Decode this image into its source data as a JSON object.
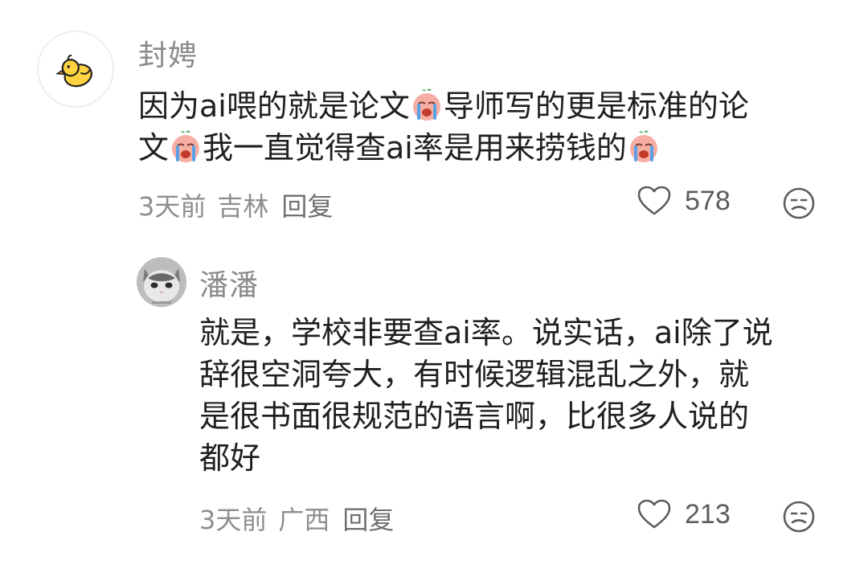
{
  "comments": [
    {
      "username": "封娉",
      "avatar_icon": "duck-avatar-icon",
      "content_segments": [
        [
          "因为ai喂的就是论文",
          "crying-emoji",
          "导师写的更是标准的论"
        ],
        [
          "文",
          "crying-emoji",
          "我一直觉得查ai率是用来捞钱的",
          "crying-emoji"
        ]
      ],
      "time": "3天前",
      "location": "吉林",
      "reply_label": "回复",
      "likes": "578"
    },
    {
      "username": "潘潘",
      "avatar_icon": "kitten-avatar-icon",
      "content_lines": [
        "就是，学校非要查ai率。说实话，ai除了说",
        "辞很空洞夸大，有时候逻辑混乱之外，就",
        "是很书面很规范的语言啊，比很多人说的",
        "都好"
      ],
      "time": "3天前",
      "location": "广西",
      "reply_label": "回复",
      "likes": "213"
    }
  ],
  "icons": {
    "like": "heart-outline-icon",
    "dislike": "unhappy-face-icon",
    "emoji": "crying-emoji"
  },
  "colors": {
    "text_primary": "#1f1f1f",
    "text_secondary": "#8e8e8e",
    "emoji_pink": "#f4a49a",
    "emoji_tear": "#5aa0e8"
  }
}
